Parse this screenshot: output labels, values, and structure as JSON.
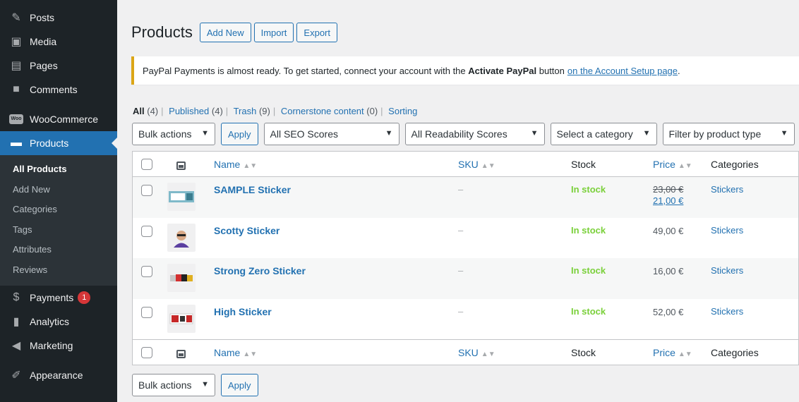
{
  "sidebar": {
    "top_items": [
      {
        "label": "Posts",
        "icon": "pin-icon"
      },
      {
        "label": "Media",
        "icon": "media-icon"
      },
      {
        "label": "Pages",
        "icon": "pages-icon"
      },
      {
        "label": "Comments",
        "icon": "comments-icon"
      }
    ],
    "woocommerce": {
      "label": "WooCommerce",
      "logo": "Woo"
    },
    "products": {
      "label": "Products"
    },
    "submenu": [
      "All Products",
      "Add New",
      "Categories",
      "Tags",
      "Attributes",
      "Reviews"
    ],
    "payments": {
      "label": "Payments",
      "badge": "1"
    },
    "analytics": {
      "label": "Analytics"
    },
    "marketing": {
      "label": "Marketing"
    },
    "appearance": {
      "label": "Appearance"
    }
  },
  "header": {
    "title": "Products",
    "add_new": "Add New",
    "import": "Import",
    "export": "Export"
  },
  "notice": {
    "text_before": "PayPal Payments is almost ready. To get started, connect your account with the",
    "bold": "Activate PayPal",
    "text_mid": "button",
    "link": "on the Account Setup page",
    "text_end": "."
  },
  "views": {
    "all": "All",
    "all_count": "(4)",
    "published": "Published",
    "published_count": "(4)",
    "trash": "Trash",
    "trash_count": "(9)",
    "cornerstone": "Cornerstone content",
    "cornerstone_count": "(0)",
    "sorting": "Sorting",
    "separator": "|"
  },
  "filters": {
    "bulk": "Bulk actions",
    "apply": "Apply",
    "seo": "All SEO Scores",
    "readability": "All Readability Scores",
    "category": "Select a category",
    "product_type": "Filter by product type"
  },
  "table": {
    "columns": {
      "name": "Name",
      "sku": "SKU",
      "stock": "Stock",
      "price": "Price",
      "categories": "Categories"
    },
    "rows": [
      {
        "name": "SAMPLE Sticker",
        "sku": "–",
        "stock": "In stock",
        "price_old": "23,00 €",
        "price_new": "21,00 €",
        "category": "Stickers"
      },
      {
        "name": "Scotty Sticker",
        "sku": "–",
        "stock": "In stock",
        "price": "49,00 €",
        "category": "Stickers"
      },
      {
        "name": "Strong Zero Sticker",
        "sku": "–",
        "stock": "In stock",
        "price": "16,00 €",
        "category": "Stickers"
      },
      {
        "name": "High Sticker",
        "sku": "–",
        "stock": "In stock",
        "price": "52,00 €",
        "category": "Stickers"
      }
    ]
  },
  "colors": {
    "accent": "#2271b1",
    "sidebar": "#1d2327",
    "in_stock": "#7ad03a",
    "notice_border": "#dba617",
    "badge": "#d63638"
  }
}
